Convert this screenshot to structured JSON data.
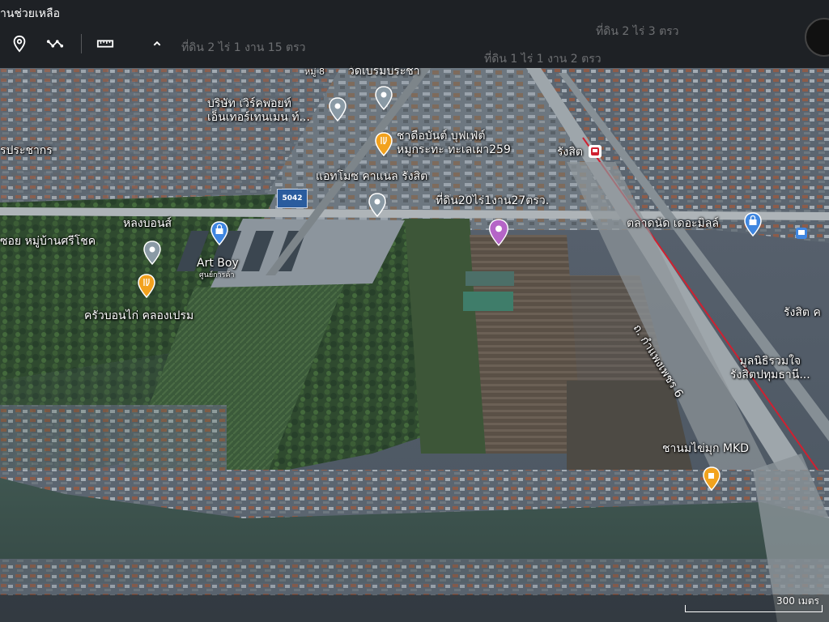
{
  "toolbar": {
    "help_text": "านช่วยเหลือ",
    "tools": [
      {
        "name": "location-pin-tool",
        "icon": "map-pin-icon"
      },
      {
        "name": "path-tool",
        "icon": "path-icon"
      },
      {
        "name": "ruler-tool",
        "icon": "ruler-icon"
      },
      {
        "name": "collapse-tool",
        "icon": "chevron-up-icon"
      }
    ],
    "ghost_labels": [
      "ที่ดิน 2 ไร่ 1 งาน 15 ตรว",
      "ที่ดิน 1 ไร่ 1 งาน 2 ตรว",
      "ที่ดิน 2 ไร่ 3 ตรว"
    ]
  },
  "map": {
    "labels": {
      "moo8": "หมู่ 8",
      "watbremprachakha": "วัดเบรมประชา",
      "works_point": "บริษัท เวิร์คพอยท์\nเอ็นเทอร์เทนเมน ท์...",
      "buffet": "ชาดือบันต์ บุฟเฟ่ต์\nหมูกระทะ ทะเลเผา259",
      "rangsit_station": "รังสิต",
      "rangsit_prachakorn": "รประชากร",
      "antmoz": "แอทโมซ คาแนล รังสิต",
      "land_20rai": "ที่ดิน20ไร่1งาน27ตรว.",
      "talad_nat": "ตลาดนัด เดอะมิลล์",
      "long_bons": "หลงบอนส์",
      "soi_muban": "ซอย หมู่บ้านศรีโชค",
      "art_boy": "Art Boy",
      "art_boy_sub": "ศูนย์การค้า",
      "krua_bon": "ครัวบอนไก่ คลองเปรม",
      "rd_kampaeng": "ถ. กำแพงเพชร 6",
      "rangsit_right": "รังสิต ค",
      "foundation": "มูลนิธิรวมใจ\nรังสิตปทุมธานี...",
      "chanom": "ชานมไข่มุก MKD",
      "road_badge": "5042"
    },
    "scale_text": "300 เมตร"
  },
  "colors": {
    "toolbar_bg": "#141618",
    "pin_gray": "#8a9aa5",
    "pin_orange": "#f2a21e",
    "pin_blue": "#3f86e0",
    "pin_purple": "#b565c7",
    "rail_red": "#d02030"
  }
}
